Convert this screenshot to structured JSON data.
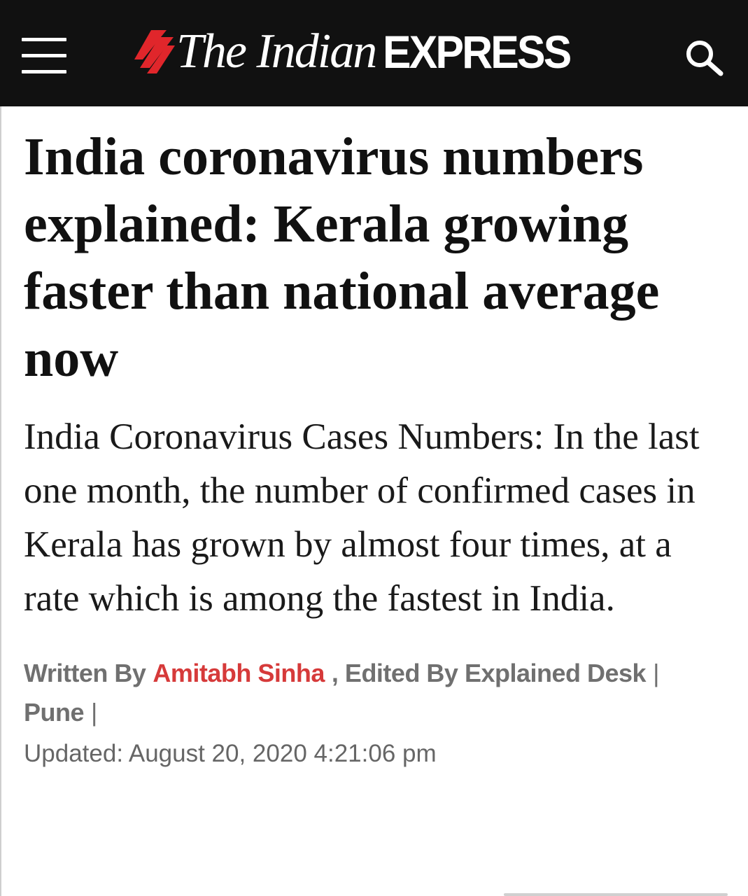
{
  "header": {
    "logo_the": "The Indian",
    "logo_express": "EXPRESS",
    "background_color": "#111111",
    "logo_mark_color": "#e0262b",
    "menu_icon": "hamburger-menu-icon",
    "search_icon": "search-icon"
  },
  "article": {
    "headline": "India coronavirus numbers explained: Kerala growing faster than national average now",
    "standfirst": "India Coronavirus Cases Numbers: In the last one month, the number of confirmed cases in Kerala has grown by almost four times, at a rate which is among the fastest in India.",
    "byline": {
      "written_by_label": "Written By",
      "author": "Amitabh Sinha",
      "edited_by_label": ", Edited By Explained Desk",
      "separator": "|",
      "location": "Pune",
      "location_separator": "|",
      "author_color": "#d63a3a"
    },
    "updated": {
      "label": "Updated:",
      "value": "August 20, 2020 4:21:06 pm"
    }
  }
}
